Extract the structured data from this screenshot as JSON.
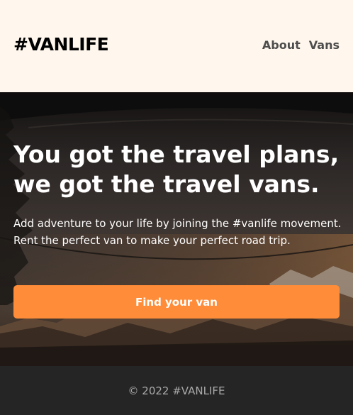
{
  "header": {
    "logo": "#VANLIFE",
    "nav": [
      {
        "label": "About"
      },
      {
        "label": "Vans"
      }
    ]
  },
  "hero": {
    "title": "You got the travel plans, we got the travel vans.",
    "text": "Add adventure to your life by joining the #vanlife movement. Rent the perfect van to make your perfect road trip.",
    "cta_label": "Find your van"
  },
  "footer": {
    "copyright": "© 2022 #VANLIFE"
  },
  "colors": {
    "header_bg": "#FFF7ED",
    "cta": "#FF8C38",
    "footer_bg": "#252525",
    "footer_text": "#AAAAAA"
  }
}
